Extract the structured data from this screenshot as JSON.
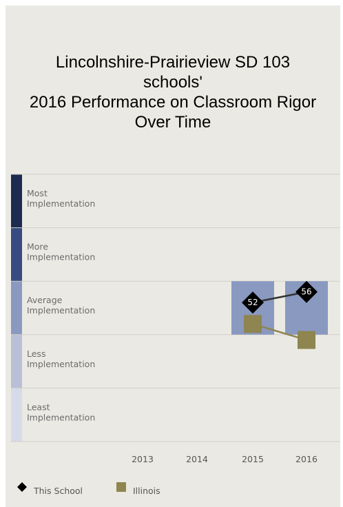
{
  "chart_data": {
    "type": "line",
    "title_lines": [
      "Lincolnshire-Prairieview SD 103",
      "schools'",
      "2016 Performance on Classroom Rigor",
      "Over Time"
    ],
    "bands": [
      {
        "label_lines": [
          "Most",
          "Implementation"
        ],
        "color": "#1c2b4f"
      },
      {
        "label_lines": [
          "More",
          "Implementation"
        ],
        "color": "#374b82"
      },
      {
        "label_lines": [
          "Average",
          "Implementation"
        ],
        "color": "#8a99c0"
      },
      {
        "label_lines": [
          "Less",
          "Implementation"
        ],
        "color": "#b9bfd6"
      },
      {
        "label_lines": [
          "Least",
          "Implementation"
        ],
        "color": "#d7dae8"
      }
    ],
    "x": [
      "2013",
      "2014",
      "2015",
      "2016"
    ],
    "ylim": [
      0,
      100
    ],
    "highlight_band": "Average Implementation",
    "highlight_years": [
      "2015",
      "2016"
    ],
    "highlight_color": "#8a99c0",
    "series": [
      {
        "name": "This School",
        "marker": "diamond",
        "color": "#000000",
        "line_color": "#333333",
        "values": [
          null,
          null,
          52,
          56
        ],
        "show_labels": true
      },
      {
        "name": "Illinois",
        "marker": "square",
        "color": "#8e8550",
        "line_color": "#8e8550",
        "values": [
          null,
          null,
          44,
          38
        ],
        "show_labels": false
      }
    ]
  }
}
